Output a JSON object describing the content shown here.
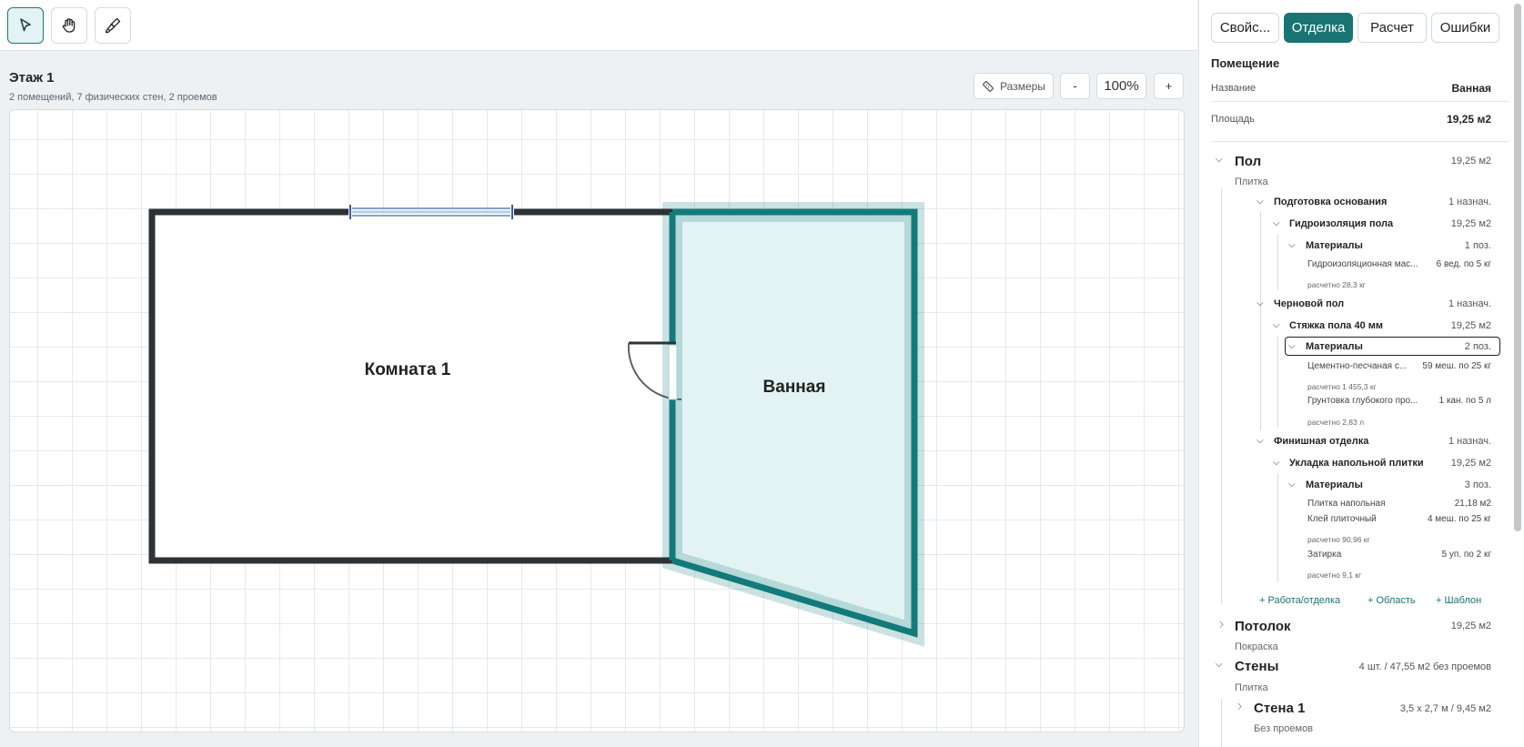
{
  "colors": {
    "accent": "#1a7474",
    "wall": "#2c3236",
    "selected_fill": "#e3f3f3",
    "selected_stroke": "#137a7a",
    "window": "#5a8ac6"
  },
  "floor": {
    "title": "Этаж 1",
    "subtitle": "2 помещений, 7 физических стен, 2 проемов"
  },
  "view": {
    "dimensions_label": "Размеры",
    "zoom_out": "-",
    "zoom": "100%",
    "zoom_in": "+"
  },
  "plan": {
    "room1_label": "Комната 1",
    "room2_label": "Ванная"
  },
  "tabs": [
    "Свойс...",
    "Отделка",
    "Расчет",
    "Ошибки"
  ],
  "room": {
    "section_title": "Помещение",
    "name_label": "Название",
    "name_value": "Ванная",
    "area_label": "Площадь",
    "area_value": "19,25 м2"
  },
  "floor_finish": {
    "title": "Пол",
    "area": "19,25 м2",
    "subtitle": "Плитка",
    "prep": {
      "title": "Подготовка основания",
      "count": "1 назнач.",
      "waterproof": {
        "title": "Гидроизоляция пола",
        "area": "19,25 м2",
        "materials_label": "Материалы",
        "materials_count": "1 поз.",
        "item1_name": "Гидроизоляционная мас...",
        "item1_qty": "6 вед. по 5 кг",
        "item1_calc": "расчетно 28,3 кг"
      }
    },
    "rough": {
      "title": "Черновой пол",
      "count": "1 назнач.",
      "screed": {
        "title": "Стяжка пола 40 мм",
        "area": "19,25 м2",
        "materials_label": "Материалы",
        "materials_count": "2 поз.",
        "item1_name": "Цементно-песчаная с...",
        "item1_qty": "59 меш. по 25 кг",
        "item1_calc": "расчетно 1 455,3 кг",
        "item2_name": "Грунтовка глубокого про...",
        "item2_qty": "1 кан. по 5 л",
        "item2_calc": "расчетно 2,83 л"
      }
    },
    "final": {
      "title": "Финишная отделка",
      "count": "1 назнач.",
      "tile": {
        "title": "Укладка напольной плитки",
        "area": "19,25 м2",
        "materials_label": "Материалы",
        "materials_count": "3 поз.",
        "item1_name": "Плитка напольная",
        "item1_qty": "21,18 м2",
        "item2_name": "Клей плиточный",
        "item2_qty": "4 меш. по 25 кг",
        "item2_calc": "расчетно 90,96 кг",
        "item3_name": "Затирка",
        "item3_qty": "5 уп. по 2 кг",
        "item3_calc": "расчетно 9,1 кг"
      }
    },
    "add_work": "+ Работа/отделка",
    "add_area": "+ Область",
    "add_template": "+ Шаблон"
  },
  "ceiling": {
    "title": "Потолок",
    "area": "19,25 м2",
    "subtitle": "Покраска"
  },
  "walls": {
    "title": "Стены",
    "summary": "4 шт. / 47,55 м2 без проемов",
    "subtitle": "Плитка",
    "wall1": {
      "title": "Стена 1",
      "size": "3,5 х 2,7 м / 9,45 м2",
      "subtitle": "Без проемов"
    }
  }
}
